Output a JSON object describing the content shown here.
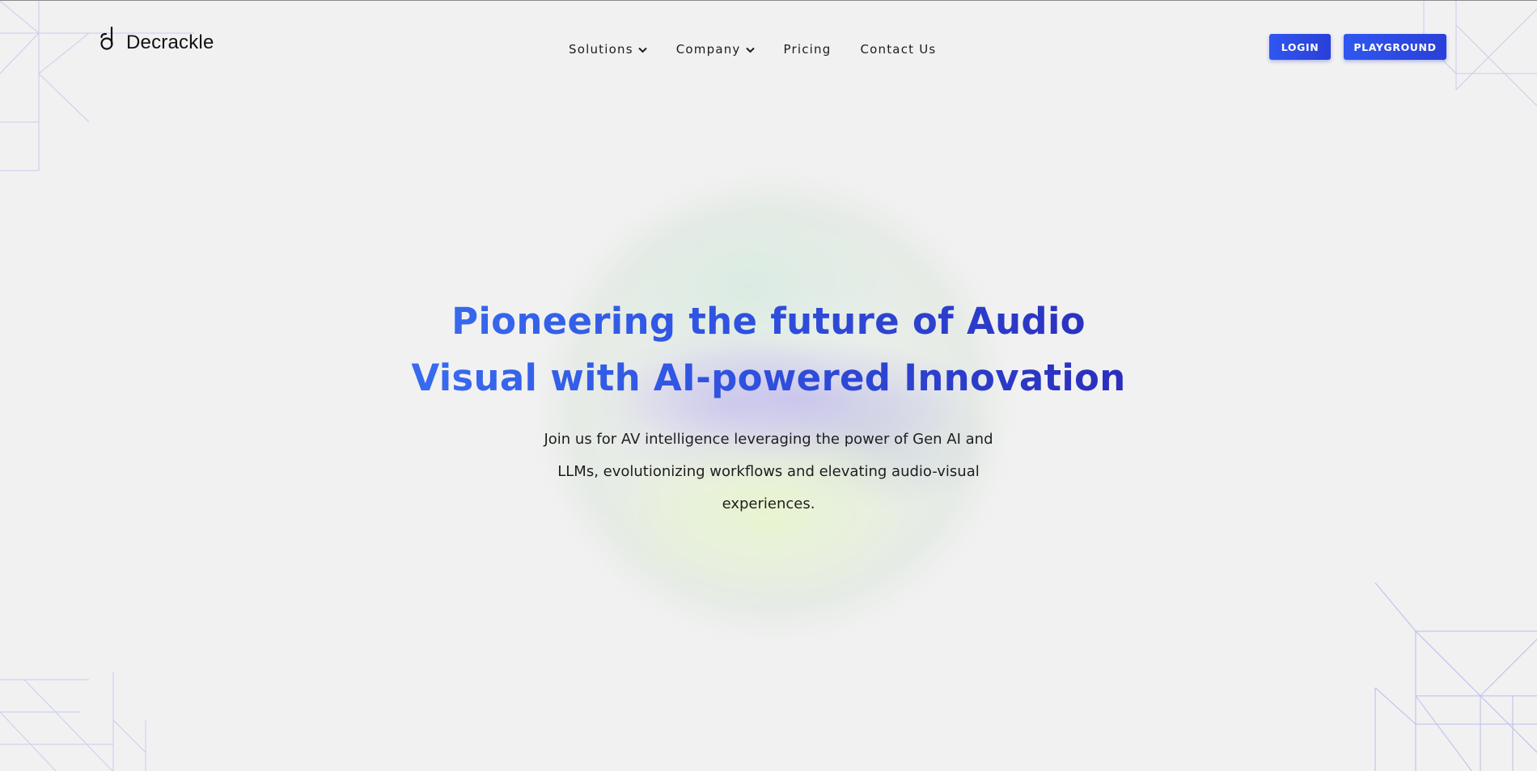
{
  "brand": {
    "name": "Decrackle",
    "logo_icon": "decrackle-logo-mark"
  },
  "nav": {
    "items": [
      {
        "label": "Solutions",
        "has_dropdown": true
      },
      {
        "label": "Company",
        "has_dropdown": true
      },
      {
        "label": "Pricing",
        "has_dropdown": false
      },
      {
        "label": "Contact Us",
        "has_dropdown": false
      }
    ]
  },
  "actions": {
    "login_label": "LOGIN",
    "playground_label": "PLAYGROUND"
  },
  "hero": {
    "title_line1": "Pioneering the future of Audio",
    "title_line2": "Visual with AI-powered Innovation",
    "subtitle_line1": "Join us for AV intelligence leveraging the power of Gen AI and",
    "subtitle_line2": "LLMs, evolutionizing workflows and elevating audio-visual",
    "subtitle_line3": "experiences."
  },
  "colors": {
    "background": "#f1f1f1",
    "accent": "#2f57f0",
    "accent_dark": "#2a2ab8",
    "text": "#1d1d1d"
  }
}
